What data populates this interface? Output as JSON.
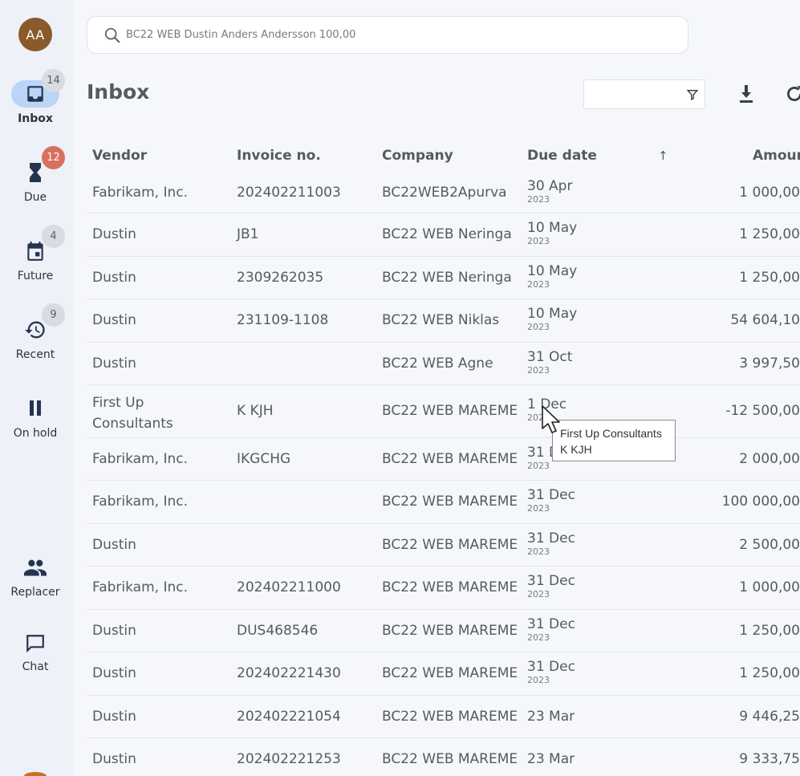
{
  "user": {
    "initials": "AA"
  },
  "nav": [
    {
      "key": "inbox",
      "label": "Inbox",
      "badge": "14",
      "active": true
    },
    {
      "key": "due",
      "label": "Due",
      "badge": "12"
    },
    {
      "key": "future",
      "label": "Future",
      "badge": "4"
    },
    {
      "key": "recent",
      "label": "Recent",
      "badge": "9"
    },
    {
      "key": "onhold",
      "label": "On hold"
    },
    {
      "key": "replacer",
      "label": "Replacer"
    },
    {
      "key": "chat",
      "label": "Chat"
    }
  ],
  "search": {
    "placeholder": "BC22 WEB Dustin Anders Andersson 100,00"
  },
  "page": {
    "title": "Inbox"
  },
  "columns": {
    "vendor": "Vendor",
    "invoice": "Invoice no.",
    "company": "Company",
    "due": "Due date",
    "amount": "Amount",
    "sort_arrow": "↑"
  },
  "rows": [
    {
      "vendor": "Fabrikam, Inc.",
      "invoice": "202402211003",
      "company": "BC22WEB2Apurva",
      "due": "30 Apr",
      "year": "2023",
      "amount": "1 000,00"
    },
    {
      "vendor": "Dustin",
      "invoice": "JB1",
      "company": "BC22 WEB Neringa",
      "due": "10 May",
      "year": "2023",
      "amount": "1 250,00"
    },
    {
      "vendor": "Dustin",
      "invoice": "2309262035",
      "company": "BC22 WEB Neringa",
      "due": "10 May",
      "year": "2023",
      "amount": "1 250,00"
    },
    {
      "vendor": "Dustin",
      "invoice": "231109-1108",
      "company": "BC22 WEB Niklas",
      "due": "10 May",
      "year": "2023",
      "amount": "54 604,10"
    },
    {
      "vendor": "Dustin",
      "invoice": "",
      "company": "BC22 WEB Agne",
      "due": "31 Oct",
      "year": "2023",
      "amount": "3 997,50"
    },
    {
      "vendor": "First Up",
      "vendor2": "Consultants",
      "invoice": "K KJH",
      "company": "BC22 WEB MAREME",
      "due": "1 Dec",
      "year": "2023",
      "amount": "-12 500,00"
    },
    {
      "vendor": "Fabrikam, Inc.",
      "invoice": "IKGCHG",
      "company": "BC22 WEB MAREME",
      "due": "31 Dec",
      "year": "2023",
      "amount": "2 000,00"
    },
    {
      "vendor": "Fabrikam, Inc.",
      "invoice": "",
      "company": "BC22 WEB MAREME",
      "due": "31 Dec",
      "year": "2023",
      "amount": "100 000,00"
    },
    {
      "vendor": "Dustin",
      "invoice": "",
      "company": "BC22 WEB MAREME",
      "due": "31 Dec",
      "year": "2023",
      "amount": "2 500,00"
    },
    {
      "vendor": "Fabrikam, Inc.",
      "invoice": "202402211000",
      "company": "BC22 WEB MAREME",
      "due": "31 Dec",
      "year": "2023",
      "amount": "1 000,00"
    },
    {
      "vendor": "Dustin",
      "invoice": "DUS468546",
      "company": "BC22 WEB MAREME",
      "due": "31 Dec",
      "year": "2023",
      "amount": "1 250,00"
    },
    {
      "vendor": "Dustin",
      "invoice": "202402221430",
      "company": "BC22 WEB MAREME",
      "due": "31 Dec",
      "year": "2023",
      "amount": "1 250,00"
    },
    {
      "vendor": "Dustin",
      "invoice": "202402221054",
      "company": "BC22 WEB MAREME",
      "due": "23 Mar",
      "year": "",
      "amount": "9 446,25"
    },
    {
      "vendor": "Dustin",
      "invoice": "202402221253",
      "company": "BC22 WEB MAREME",
      "due": "23 Mar",
      "year": "",
      "amount": "9 333,75"
    }
  ],
  "tooltip": {
    "line1": "First Up Consultants",
    "line2": "K KJH"
  },
  "colors": {
    "accent": "#bcd4f7",
    "badge_red": "#d8705f",
    "avatar": "#8a5a2b",
    "icon": "#253450"
  }
}
